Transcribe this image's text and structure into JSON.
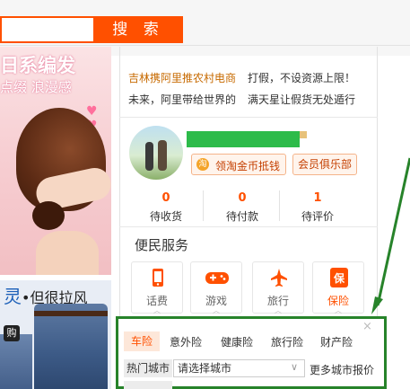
{
  "search": {
    "button_label": "搜 索"
  },
  "banner_top": {
    "line1": "日系编发",
    "line2": "点缀 浪漫感"
  },
  "banner_bottom": {
    "text_a": "灵",
    "text_b": "•但很拉风",
    "badge": "购"
  },
  "news": {
    "row1_left": "吉林携阿里推农村电商",
    "row1_right": "打假，不设资源上限！",
    "row2_left": "未来，阿里带给世界的",
    "row2_right": "满天星让假货无处遁行"
  },
  "user": {
    "coin_icon": "淘",
    "coin_button": "领淘金币抵钱",
    "club_button": "会员俱乐部",
    "stats": [
      {
        "value": "0",
        "label": "待收货"
      },
      {
        "value": "0",
        "label": "待付款"
      },
      {
        "value": "1",
        "label": "待评价"
      }
    ]
  },
  "services": {
    "title": "便民服务",
    "items": [
      {
        "label": "话费",
        "icon": "phone-icon"
      },
      {
        "label": "游戏",
        "icon": "gamepad-icon"
      },
      {
        "label": "旅行",
        "icon": "airplane-icon"
      },
      {
        "label": "保险",
        "icon": "insurance-icon",
        "icon_text": "保"
      }
    ]
  },
  "insurance": {
    "close": "×",
    "tabs": [
      "车险",
      "意外险",
      "健康险",
      "旅行险",
      "财产险"
    ],
    "city_label": "热门城市",
    "city_placeholder": "请选择城市",
    "city_chevron": "∨",
    "more_link": "更多城市报价"
  },
  "colors": {
    "accent": "#ff5000",
    "highlight": "#27832a",
    "stat": "#ff5000"
  }
}
